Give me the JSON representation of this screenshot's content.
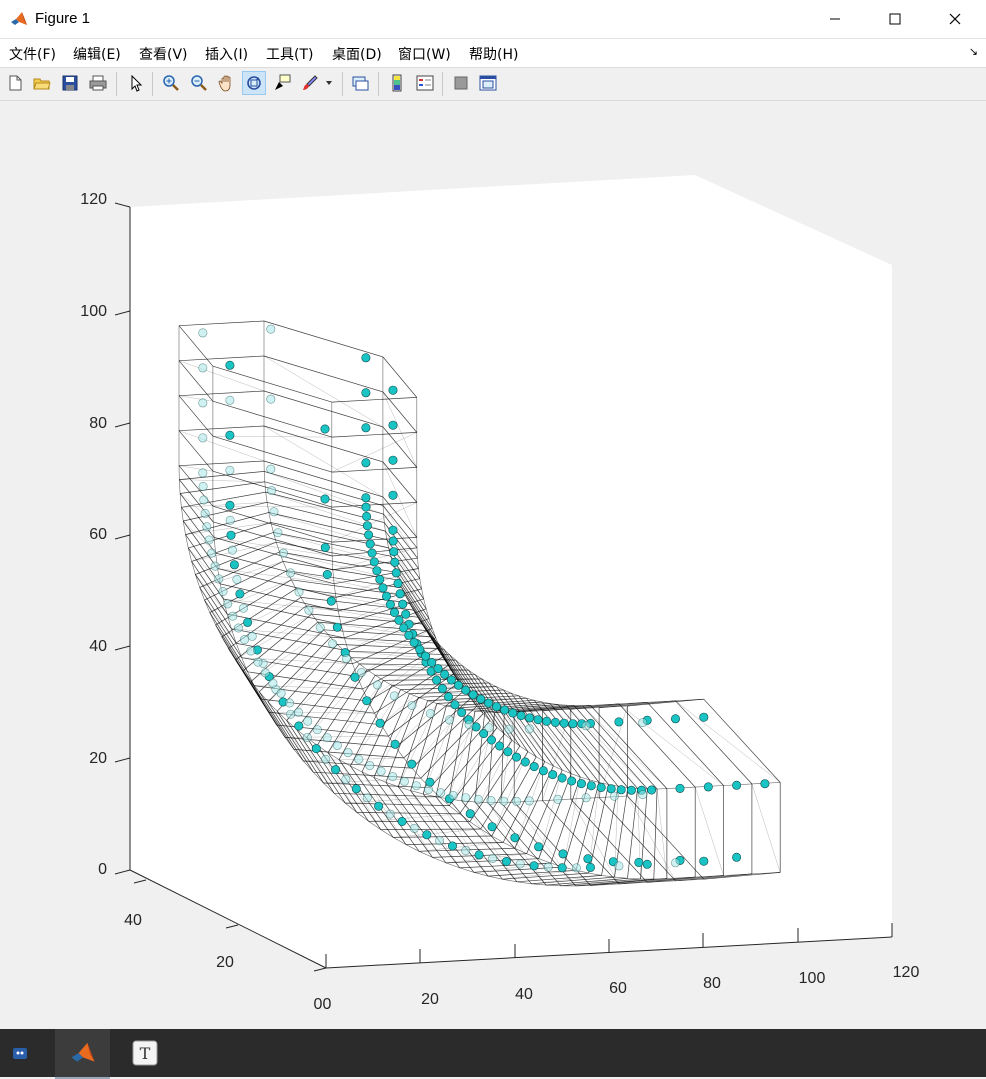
{
  "window": {
    "title": "Figure 1",
    "controls": [
      "minimize-icon",
      "maximize-icon",
      "close-icon"
    ]
  },
  "menu": {
    "items": [
      "文件(F)",
      "编辑(E)",
      "查看(V)",
      "插入(I)",
      "工具(T)",
      "桌面(D)",
      "窗口(W)",
      "帮助(H)"
    ]
  },
  "toolbar": {
    "buttons": [
      "new-figure-icon",
      "open-file-icon",
      "save-icon",
      "print-icon",
      "edit-plot-icon",
      "zoom-in-icon",
      "zoom-out-icon",
      "pan-icon",
      "rotate-3d-icon",
      "data-cursor-icon",
      "brush-icon",
      "link-plot-icon",
      "insert-colorbar-icon",
      "insert-legend-icon",
      "hide-plot-tools-icon",
      "show-plot-tools-icon"
    ]
  },
  "axes": {
    "z_ticks": [
      "0",
      "20",
      "40",
      "60",
      "80",
      "100",
      "120"
    ],
    "x_ticks": [
      "0",
      "20",
      "40",
      "60",
      "80",
      "100",
      "120"
    ],
    "y_ticks": [
      "0",
      "20",
      "40"
    ]
  },
  "colors": {
    "marker": "#1bc4c4",
    "marker_light": "#a8e6e6",
    "mesh": "#000000",
    "axes_bg": "#ffffff",
    "figure_bg": "#f0f0f0"
  },
  "taskbar": {
    "items": [
      "app-icon-1",
      "matlab-icon",
      "typora-icon"
    ]
  }
}
